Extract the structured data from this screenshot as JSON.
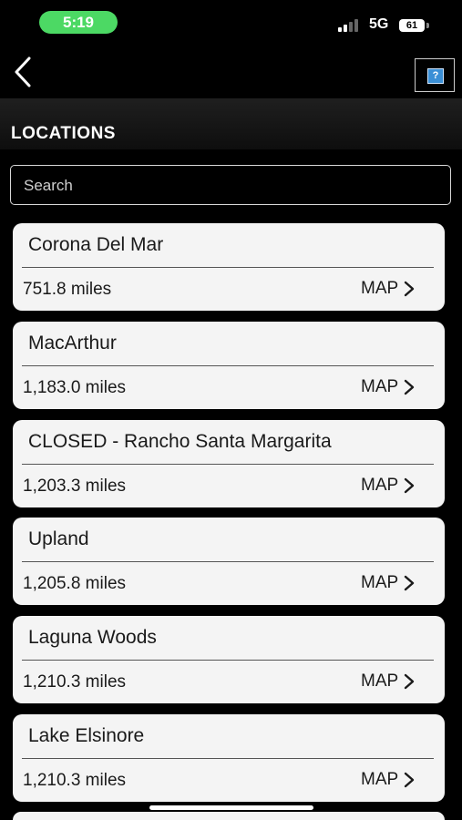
{
  "status_bar": {
    "time": "5:19",
    "network": "5G",
    "battery": "61"
  },
  "header": {
    "section_title": "LOCATIONS"
  },
  "search": {
    "placeholder": "Search"
  },
  "locations": [
    {
      "name": "Corona Del Mar",
      "distance": "751.8 miles",
      "map_label": "MAP"
    },
    {
      "name": "MacArthur",
      "distance": "1,183.0 miles",
      "map_label": "MAP"
    },
    {
      "name": "CLOSED - Rancho Santa Margarita",
      "distance": "1,203.3 miles",
      "map_label": "MAP"
    },
    {
      "name": "Upland",
      "distance": "1,205.8 miles",
      "map_label": "MAP"
    },
    {
      "name": "Laguna Woods",
      "distance": "1,210.3 miles",
      "map_label": "MAP"
    },
    {
      "name": "Lake Elsinore",
      "distance": "1,210.3 miles",
      "map_label": "MAP"
    }
  ],
  "colors": {
    "time_pill": "#4cd964",
    "card_bg": "#f4f4f4",
    "help_icon": "#3a8fd6"
  }
}
